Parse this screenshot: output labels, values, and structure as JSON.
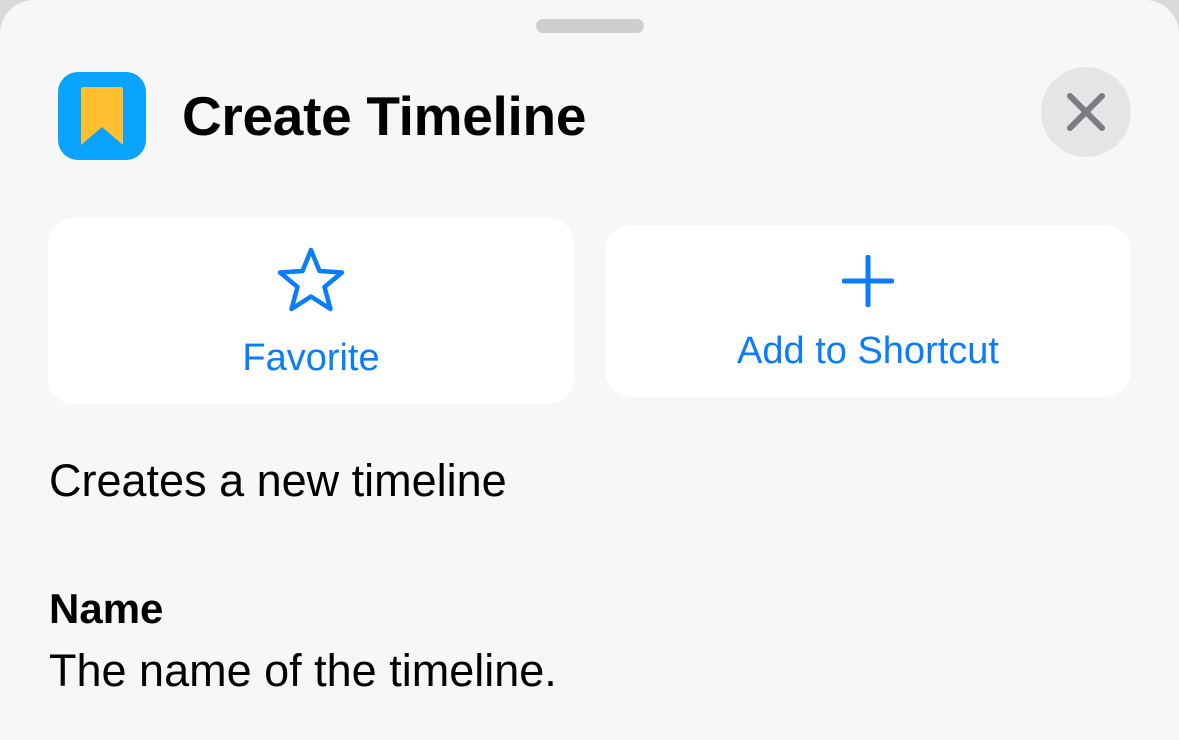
{
  "sheet": {
    "title": "Create Timeline",
    "app_icon": "bookmark-app-icon",
    "close_icon": "close-icon"
  },
  "actions": {
    "favorite": {
      "label": "Favorite",
      "icon": "star-icon"
    },
    "add_to_shortcut": {
      "label": "Add to Shortcut",
      "icon": "plus-icon"
    }
  },
  "description": "Creates a new timeline",
  "parameters": [
    {
      "name": "Name",
      "description": "The name of the timeline."
    }
  ],
  "colors": {
    "accent": "#0a7cff",
    "app_icon_bg": "#0aa4ff",
    "bookmark": "#ffbf2e",
    "sheet_bg": "#f7f7f7",
    "card_bg": "#ffffff"
  }
}
